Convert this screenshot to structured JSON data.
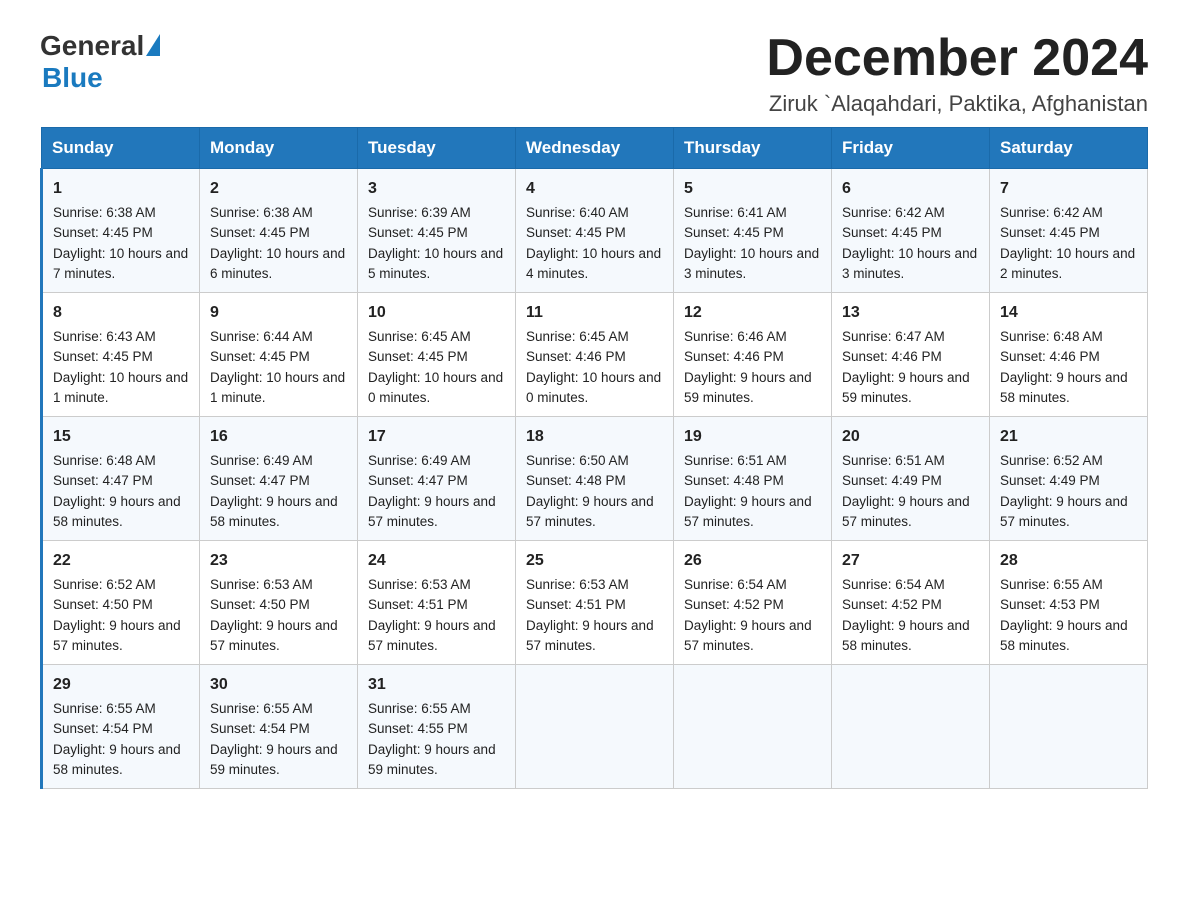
{
  "header": {
    "logo_general": "General",
    "logo_blue": "Blue",
    "title": "December 2024",
    "subtitle": "Ziruk `Alaqahdari, Paktika, Afghanistan"
  },
  "days_of_week": [
    "Sunday",
    "Monday",
    "Tuesday",
    "Wednesday",
    "Thursday",
    "Friday",
    "Saturday"
  ],
  "weeks": [
    [
      {
        "num": "1",
        "sunrise": "Sunrise: 6:38 AM",
        "sunset": "Sunset: 4:45 PM",
        "daylight": "Daylight: 10 hours and 7 minutes."
      },
      {
        "num": "2",
        "sunrise": "Sunrise: 6:38 AM",
        "sunset": "Sunset: 4:45 PM",
        "daylight": "Daylight: 10 hours and 6 minutes."
      },
      {
        "num": "3",
        "sunrise": "Sunrise: 6:39 AM",
        "sunset": "Sunset: 4:45 PM",
        "daylight": "Daylight: 10 hours and 5 minutes."
      },
      {
        "num": "4",
        "sunrise": "Sunrise: 6:40 AM",
        "sunset": "Sunset: 4:45 PM",
        "daylight": "Daylight: 10 hours and 4 minutes."
      },
      {
        "num": "5",
        "sunrise": "Sunrise: 6:41 AM",
        "sunset": "Sunset: 4:45 PM",
        "daylight": "Daylight: 10 hours and 3 minutes."
      },
      {
        "num": "6",
        "sunrise": "Sunrise: 6:42 AM",
        "sunset": "Sunset: 4:45 PM",
        "daylight": "Daylight: 10 hours and 3 minutes."
      },
      {
        "num": "7",
        "sunrise": "Sunrise: 6:42 AM",
        "sunset": "Sunset: 4:45 PM",
        "daylight": "Daylight: 10 hours and 2 minutes."
      }
    ],
    [
      {
        "num": "8",
        "sunrise": "Sunrise: 6:43 AM",
        "sunset": "Sunset: 4:45 PM",
        "daylight": "Daylight: 10 hours and 1 minute."
      },
      {
        "num": "9",
        "sunrise": "Sunrise: 6:44 AM",
        "sunset": "Sunset: 4:45 PM",
        "daylight": "Daylight: 10 hours and 1 minute."
      },
      {
        "num": "10",
        "sunrise": "Sunrise: 6:45 AM",
        "sunset": "Sunset: 4:45 PM",
        "daylight": "Daylight: 10 hours and 0 minutes."
      },
      {
        "num": "11",
        "sunrise": "Sunrise: 6:45 AM",
        "sunset": "Sunset: 4:46 PM",
        "daylight": "Daylight: 10 hours and 0 minutes."
      },
      {
        "num": "12",
        "sunrise": "Sunrise: 6:46 AM",
        "sunset": "Sunset: 4:46 PM",
        "daylight": "Daylight: 9 hours and 59 minutes."
      },
      {
        "num": "13",
        "sunrise": "Sunrise: 6:47 AM",
        "sunset": "Sunset: 4:46 PM",
        "daylight": "Daylight: 9 hours and 59 minutes."
      },
      {
        "num": "14",
        "sunrise": "Sunrise: 6:48 AM",
        "sunset": "Sunset: 4:46 PM",
        "daylight": "Daylight: 9 hours and 58 minutes."
      }
    ],
    [
      {
        "num": "15",
        "sunrise": "Sunrise: 6:48 AM",
        "sunset": "Sunset: 4:47 PM",
        "daylight": "Daylight: 9 hours and 58 minutes."
      },
      {
        "num": "16",
        "sunrise": "Sunrise: 6:49 AM",
        "sunset": "Sunset: 4:47 PM",
        "daylight": "Daylight: 9 hours and 58 minutes."
      },
      {
        "num": "17",
        "sunrise": "Sunrise: 6:49 AM",
        "sunset": "Sunset: 4:47 PM",
        "daylight": "Daylight: 9 hours and 57 minutes."
      },
      {
        "num": "18",
        "sunrise": "Sunrise: 6:50 AM",
        "sunset": "Sunset: 4:48 PM",
        "daylight": "Daylight: 9 hours and 57 minutes."
      },
      {
        "num": "19",
        "sunrise": "Sunrise: 6:51 AM",
        "sunset": "Sunset: 4:48 PM",
        "daylight": "Daylight: 9 hours and 57 minutes."
      },
      {
        "num": "20",
        "sunrise": "Sunrise: 6:51 AM",
        "sunset": "Sunset: 4:49 PM",
        "daylight": "Daylight: 9 hours and 57 minutes."
      },
      {
        "num": "21",
        "sunrise": "Sunrise: 6:52 AM",
        "sunset": "Sunset: 4:49 PM",
        "daylight": "Daylight: 9 hours and 57 minutes."
      }
    ],
    [
      {
        "num": "22",
        "sunrise": "Sunrise: 6:52 AM",
        "sunset": "Sunset: 4:50 PM",
        "daylight": "Daylight: 9 hours and 57 minutes."
      },
      {
        "num": "23",
        "sunrise": "Sunrise: 6:53 AM",
        "sunset": "Sunset: 4:50 PM",
        "daylight": "Daylight: 9 hours and 57 minutes."
      },
      {
        "num": "24",
        "sunrise": "Sunrise: 6:53 AM",
        "sunset": "Sunset: 4:51 PM",
        "daylight": "Daylight: 9 hours and 57 minutes."
      },
      {
        "num": "25",
        "sunrise": "Sunrise: 6:53 AM",
        "sunset": "Sunset: 4:51 PM",
        "daylight": "Daylight: 9 hours and 57 minutes."
      },
      {
        "num": "26",
        "sunrise": "Sunrise: 6:54 AM",
        "sunset": "Sunset: 4:52 PM",
        "daylight": "Daylight: 9 hours and 57 minutes."
      },
      {
        "num": "27",
        "sunrise": "Sunrise: 6:54 AM",
        "sunset": "Sunset: 4:52 PM",
        "daylight": "Daylight: 9 hours and 58 minutes."
      },
      {
        "num": "28",
        "sunrise": "Sunrise: 6:55 AM",
        "sunset": "Sunset: 4:53 PM",
        "daylight": "Daylight: 9 hours and 58 minutes."
      }
    ],
    [
      {
        "num": "29",
        "sunrise": "Sunrise: 6:55 AM",
        "sunset": "Sunset: 4:54 PM",
        "daylight": "Daylight: 9 hours and 58 minutes."
      },
      {
        "num": "30",
        "sunrise": "Sunrise: 6:55 AM",
        "sunset": "Sunset: 4:54 PM",
        "daylight": "Daylight: 9 hours and 59 minutes."
      },
      {
        "num": "31",
        "sunrise": "Sunrise: 6:55 AM",
        "sunset": "Sunset: 4:55 PM",
        "daylight": "Daylight: 9 hours and 59 minutes."
      },
      {
        "num": "",
        "sunrise": "",
        "sunset": "",
        "daylight": ""
      },
      {
        "num": "",
        "sunrise": "",
        "sunset": "",
        "daylight": ""
      },
      {
        "num": "",
        "sunrise": "",
        "sunset": "",
        "daylight": ""
      },
      {
        "num": "",
        "sunrise": "",
        "sunset": "",
        "daylight": ""
      }
    ]
  ]
}
